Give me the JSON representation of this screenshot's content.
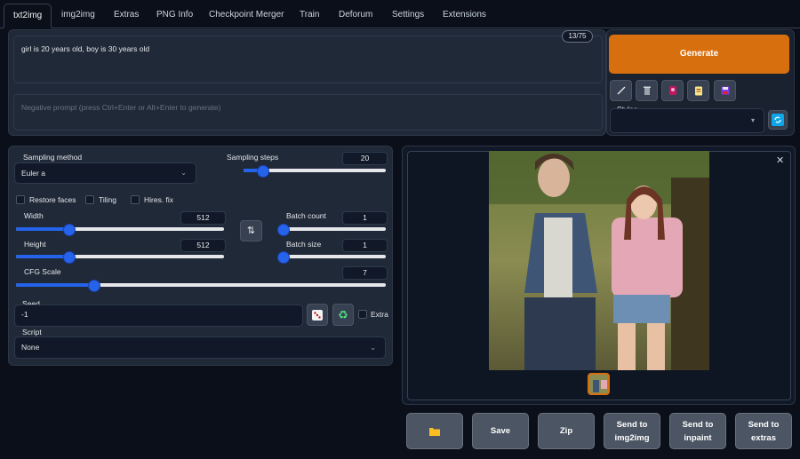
{
  "tabs": [
    "txt2img",
    "img2img",
    "Extras",
    "PNG Info",
    "Checkpoint Merger",
    "Train",
    "Deforum",
    "Settings",
    "Extensions"
  ],
  "prompt": {
    "value": "girl is 20 years old, boy is 30 years old",
    "token_counter": "13/75",
    "negative_placeholder": "Negative prompt (press Ctrl+Enter or Alt+Enter to generate)"
  },
  "generate_label": "Generate",
  "styles": {
    "label": "Styles"
  },
  "settings": {
    "sampling_method": {
      "label": "Sampling method",
      "value": "Euler a"
    },
    "sampling_steps": {
      "label": "Sampling steps",
      "value": "20",
      "fraction": 0.13
    },
    "restore_faces": "Restore faces",
    "tiling": "Tiling",
    "hires_fix": "Hires. fix",
    "width": {
      "label": "Width",
      "value": "512",
      "fraction": 0.25
    },
    "height": {
      "label": "Height",
      "value": "512",
      "fraction": 0.25
    },
    "batch_count": {
      "label": "Batch count",
      "value": "1",
      "fraction": 0.0
    },
    "batch_size": {
      "label": "Batch size",
      "value": "1",
      "fraction": 0.0
    },
    "cfg_scale": {
      "label": "CFG Scale",
      "value": "7",
      "fraction": 0.21
    },
    "seed": {
      "label": "Seed",
      "value": "-1"
    },
    "extra": "Extra",
    "script": {
      "label": "Script",
      "value": "None"
    }
  },
  "output_buttons": {
    "save": "Save",
    "zip": "Zip",
    "send_img2img": [
      "Send to",
      "img2img"
    ],
    "send_inpaint": [
      "Send to",
      "inpaint"
    ],
    "send_extras": [
      "Send to",
      "extras"
    ]
  },
  "colors": {
    "accent": "#d86f0e",
    "slider": "#2563eb",
    "background": "#0b0f19",
    "panel": "#1f2937"
  },
  "icons": [
    "paint-brush-icon",
    "trash-icon",
    "pink-card-icon",
    "clipboard-icon",
    "save-disk-icon",
    "refresh-icon",
    "swap-icon",
    "dice-icon",
    "recycle-icon",
    "folder-icon",
    "close-icon"
  ]
}
